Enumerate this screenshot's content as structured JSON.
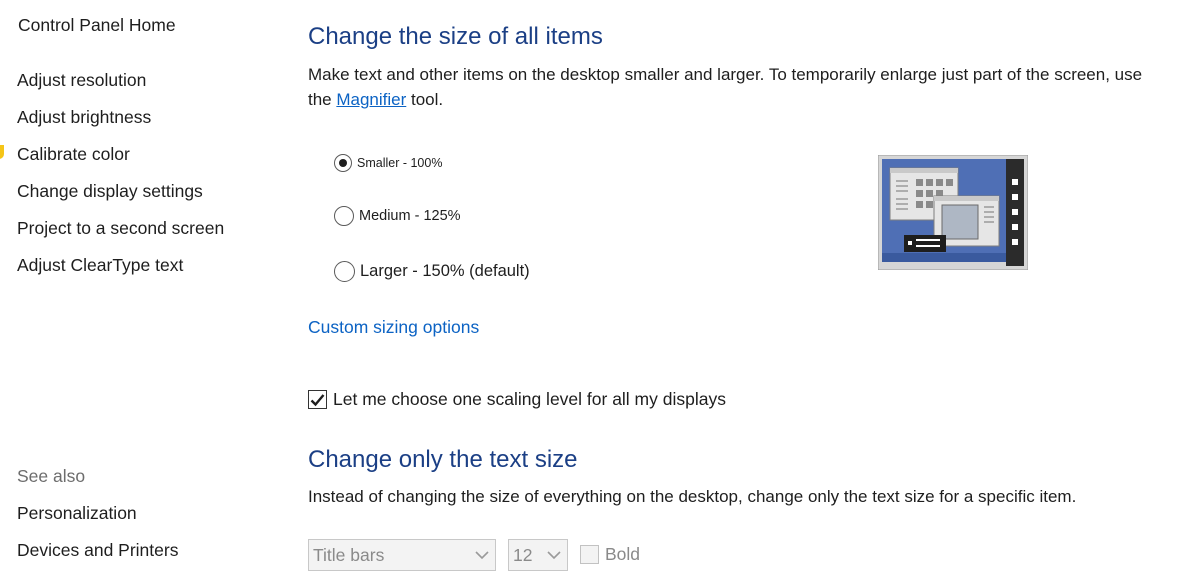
{
  "sidebar": {
    "home": "Control Panel Home",
    "items": [
      {
        "label": "Adjust resolution"
      },
      {
        "label": "Adjust brightness"
      },
      {
        "label": "Calibrate color"
      },
      {
        "label": "Change display settings"
      },
      {
        "label": "Project to a second screen"
      },
      {
        "label": "Adjust ClearType text"
      }
    ],
    "see_also": {
      "heading": "See also",
      "items": [
        {
          "label": "Personalization"
        },
        {
          "label": "Devices and Printers"
        }
      ]
    }
  },
  "main": {
    "section1": {
      "title": "Change the size of all items",
      "desc_before": "Make text and other items on the desktop smaller and larger. To temporarily enlarge just part of the screen, use the ",
      "desc_link": "Magnifier",
      "desc_after": " tool.",
      "options": [
        {
          "label": "Smaller - 100%",
          "selected": true
        },
        {
          "label": "Medium - 125%",
          "selected": false
        },
        {
          "label": "Larger - 150% (default)",
          "selected": false
        }
      ],
      "custom_link": "Custom sizing options",
      "checkbox": {
        "label": "Let me choose one scaling level for all my displays",
        "checked": true
      }
    },
    "section2": {
      "title": "Change only the text size",
      "desc": "Instead of changing the size of everything on the desktop, change only the text size for a specific item.",
      "item_select": {
        "value": "Title bars"
      },
      "size_select": {
        "value": "12"
      },
      "bold": {
        "label": "Bold",
        "checked": false
      }
    }
  },
  "colors": {
    "accent": "#0c63c4",
    "heading": "#1b3f85",
    "preview_bg": "#4f6fb5"
  }
}
